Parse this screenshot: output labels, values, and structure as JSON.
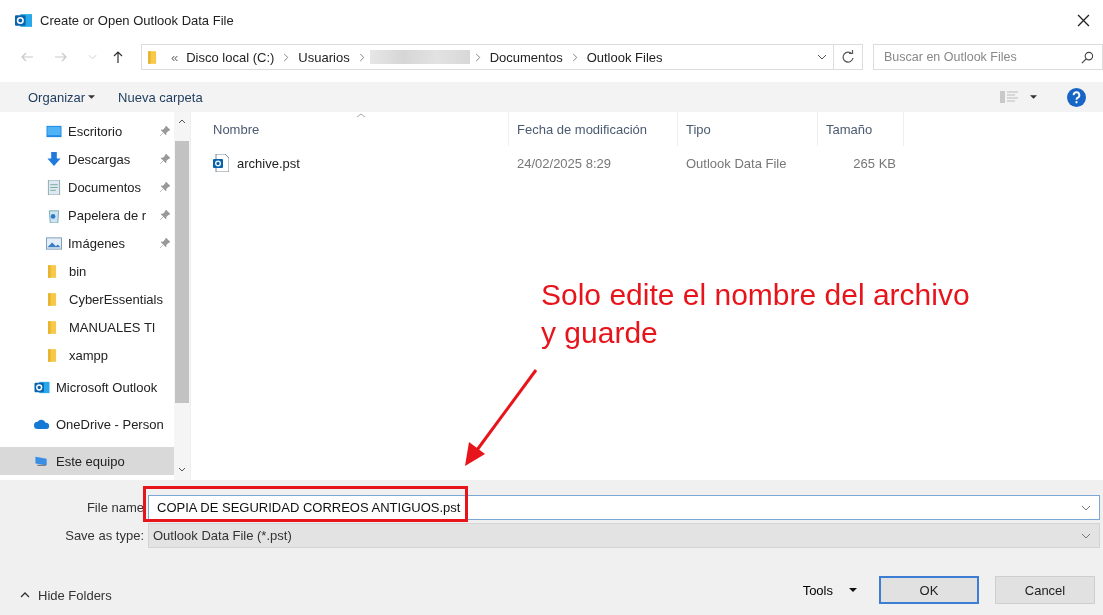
{
  "window": {
    "title": "Create or Open Outlook Data File"
  },
  "address": {
    "path": [
      {
        "kind": "chevrons",
        "label": "«"
      },
      {
        "kind": "text",
        "label": "Disco local (C:)"
      },
      {
        "kind": "text",
        "label": "Usuarios"
      },
      {
        "kind": "redacted"
      },
      {
        "kind": "text",
        "label": "Documentos"
      },
      {
        "kind": "text",
        "label": "Outlook Files"
      }
    ]
  },
  "search": {
    "placeholder": "Buscar en Outlook Files"
  },
  "toolbar": {
    "organize": "Organizar",
    "new_folder": "Nueva carpeta"
  },
  "sidebar": {
    "items": [
      {
        "label": "Escritorio",
        "kind": "desktop",
        "pinned": true,
        "selected": false
      },
      {
        "label": "Descargas",
        "kind": "download",
        "pinned": true,
        "selected": false
      },
      {
        "label": "Documentos",
        "kind": "document",
        "pinned": true,
        "selected": false
      },
      {
        "label": "Papelera de r",
        "kind": "recycle",
        "pinned": true,
        "selected": false
      },
      {
        "label": "Imágenes",
        "kind": "image",
        "pinned": true,
        "selected": false
      },
      {
        "label": "bin",
        "kind": "folder",
        "pinned": false,
        "selected": false
      },
      {
        "label": "CyberEssentials",
        "kind": "folder",
        "pinned": false,
        "selected": false
      },
      {
        "label": "MANUALES TI",
        "kind": "folder",
        "pinned": false,
        "selected": false
      },
      {
        "label": "xampp",
        "kind": "folder",
        "pinned": false,
        "selected": false
      },
      {
        "label": "Microsoft Outlook",
        "kind": "outlook",
        "pinned": false,
        "selected": false
      },
      {
        "label": "OneDrive - Person",
        "kind": "onedrive",
        "pinned": false,
        "selected": false
      },
      {
        "label": "Este equipo",
        "kind": "pc",
        "pinned": false,
        "selected": true
      }
    ]
  },
  "table": {
    "columns": [
      "Nombre",
      "Fecha de modificación",
      "Tipo",
      "Tamaño"
    ],
    "rows": [
      {
        "name": "archive.pst",
        "date": "24/02/2025 8:29",
        "type": "Outlook Data File",
        "size": "265 KB"
      }
    ]
  },
  "form": {
    "file_name_label": "File name",
    "file_name": "COPIA DE SEGURIDAD CORREOS ANTIGUOS.pst",
    "type_label": "Save as type:",
    "type_value": "Outlook Data File (*.pst)"
  },
  "footer": {
    "hide_folders": "Hide Folders",
    "tools": "Tools",
    "ok": "OK",
    "cancel": "Cancel"
  },
  "annotation": {
    "text": "Solo edite el nombre del archivo y guarde"
  }
}
